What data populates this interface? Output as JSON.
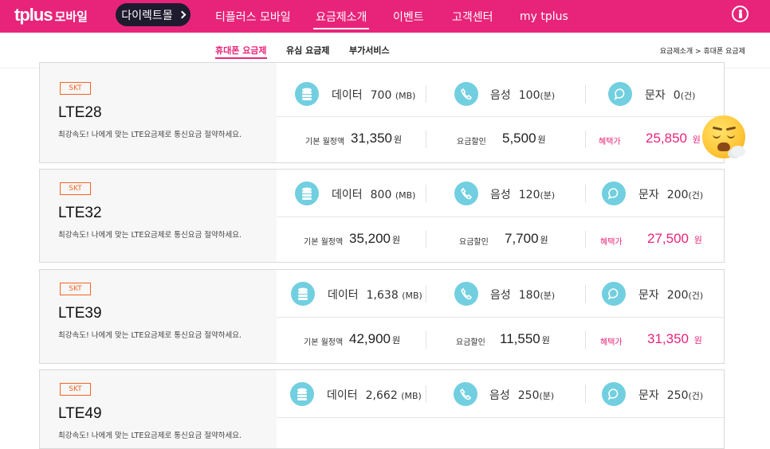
{
  "header": {
    "logo_main": "tplus",
    "logo_sub": "모바일",
    "direct_btn": "다이렉트몰",
    "nav": [
      {
        "label": "티플러스 모바일"
      },
      {
        "label": "요금제소개"
      },
      {
        "label": "이벤트"
      },
      {
        "label": "고객센터"
      },
      {
        "label": "my tplus"
      }
    ]
  },
  "subnav": {
    "tabs": [
      "휴대폰 요금제",
      "유심 요금제",
      "부가서비스"
    ],
    "breadcrumb": "요금제소개 > 휴대폰 요금제"
  },
  "labels": {
    "data": "데이터",
    "data_unit": "(MB)",
    "voice": "음성",
    "voice_unit": "(분)",
    "sms": "문자",
    "sms_unit": "(건)",
    "base_fee": "기본 월정액",
    "discount": "요금할인",
    "benefit": "혜택가",
    "won": "원"
  },
  "plans": [
    {
      "carrier": "SKT",
      "name": "LTE28",
      "desc": "최강속도! 나에게 맞는 LTE요금제로 통신요금 절약하세요.",
      "data": "700",
      "voice": "100",
      "sms": "0",
      "base_fee": "31,350",
      "discount": "5,500",
      "benefit": "25,850"
    },
    {
      "carrier": "SKT",
      "name": "LTE32",
      "desc": "최강속도! 나에게 맞는 LTE요금제로 통신요금 절약하세요.",
      "data": "800",
      "voice": "120",
      "sms": "200",
      "base_fee": "35,200",
      "discount": "7,700",
      "benefit": "27,500"
    },
    {
      "carrier": "SKT",
      "name": "LTE39",
      "desc": "최강속도! 나에게 맞는 LTE요금제로 통신요금 절약하세요.",
      "data": "1,638",
      "voice": "180",
      "sms": "200",
      "base_fee": "42,900",
      "discount": "11,550",
      "benefit": "31,350"
    },
    {
      "carrier": "SKT",
      "name": "LTE49",
      "desc": "최강속도! 나에게 맞는 LTE요금제로 통신요금 절약하세요.",
      "data": "2,662",
      "voice": "250",
      "sms": "250"
    }
  ],
  "colors": {
    "brand": "#e8247a",
    "tag": "#f26522",
    "icon_bg": "#71cfe0"
  }
}
